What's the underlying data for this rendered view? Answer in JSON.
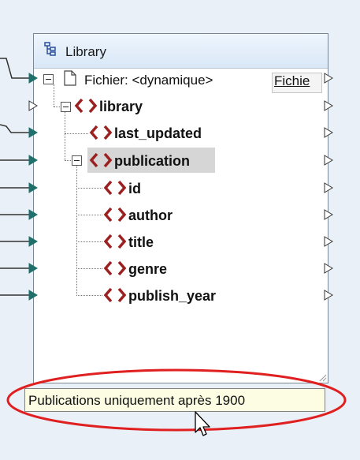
{
  "component": {
    "title": "Library",
    "file_label": "Fichier: <dynamique>",
    "file_button": "Fichie"
  },
  "tree": {
    "root": "library",
    "last_updated": "last_updated",
    "publication": "publication",
    "fields": [
      "id",
      "author",
      "title",
      "genre",
      "publish_year"
    ]
  },
  "tooltip": {
    "text": "Publications uniquement après 1900"
  },
  "colors": {
    "tag_icon": "#9b2020",
    "connector_arrow": "#1f6f6a",
    "annotation_ellipse": "#e02020",
    "tooltip_bg": "#fdfde3"
  },
  "icons": {
    "component": "tree-structure-icon",
    "file": "document-icon",
    "element": "xml-element-icon",
    "expander": "collapse-icon",
    "port": "connector-triangle-icon",
    "cursor": "mouse-pointer-icon"
  }
}
